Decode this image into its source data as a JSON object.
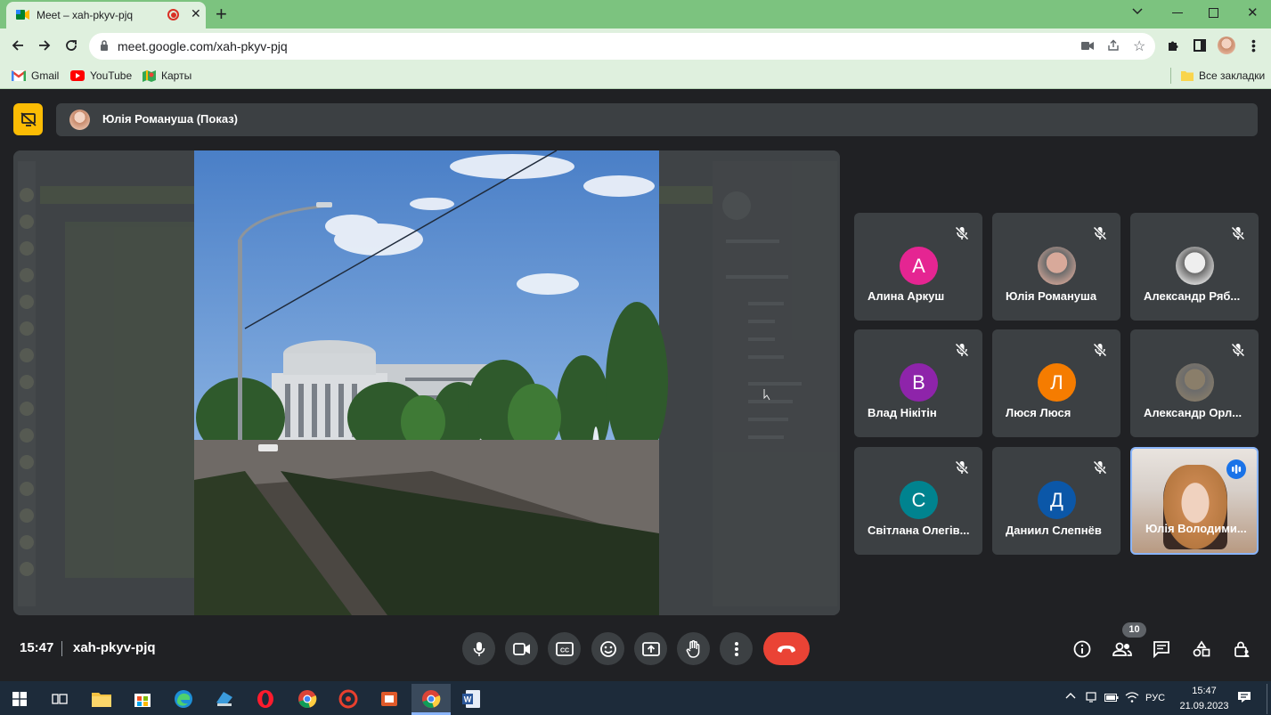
{
  "browser": {
    "tab_title": "Meet – xah-pkyv-pjq",
    "new_tab": "+",
    "url": "meet.google.com/xah-pkyv-pjq",
    "bookmarks": [
      {
        "label": "Gmail",
        "icon": "gmail-icon"
      },
      {
        "label": "YouTube",
        "icon": "youtube-icon"
      },
      {
        "label": "Карты",
        "icon": "maps-icon"
      }
    ],
    "all_bookmarks": "Все закладки"
  },
  "presentation": {
    "presenter": "Юлія Романуша (Показ)"
  },
  "participants": [
    {
      "name": "Алина Аркуш",
      "initial": "А",
      "color": "#e52592",
      "muted": true,
      "photo": false
    },
    {
      "name": "Юлія Романуша",
      "initial": "",
      "color": "#d8a99a",
      "muted": true,
      "photo": true
    },
    {
      "name": "Александр Ряб...",
      "initial": "",
      "color": "#eeeeee",
      "muted": true,
      "photo": true
    },
    {
      "name": "Влад Нікітін",
      "initial": "В",
      "color": "#8e24aa",
      "muted": true,
      "photo": false
    },
    {
      "name": "Люся Люся",
      "initial": "Л",
      "color": "#f57c00",
      "muted": true,
      "photo": false
    },
    {
      "name": "Александр Орл...",
      "initial": "",
      "color": "#8a7e6a",
      "muted": true,
      "photo": true
    },
    {
      "name": "Світлана Олегів...",
      "initial": "С",
      "color": "#00838f",
      "muted": true,
      "photo": false
    },
    {
      "name": "Даниил Слепнёв",
      "initial": "Д",
      "color": "#0b57a8",
      "muted": true,
      "photo": false
    },
    {
      "name": "Юлія Володими...",
      "initial": "",
      "color": "#8ab4f8",
      "muted": false,
      "photo": true,
      "speaking": true
    }
  ],
  "meeting": {
    "time": "15:47",
    "code": "xah-pkyv-pjq",
    "participant_count": "10"
  },
  "colors": {
    "accent": "#8ab4f8",
    "hangup": "#ea4335",
    "present_badge": "#fbbc04"
  },
  "taskbar": {
    "language": "РУС",
    "time": "15:47",
    "date": "21.09.2023"
  }
}
